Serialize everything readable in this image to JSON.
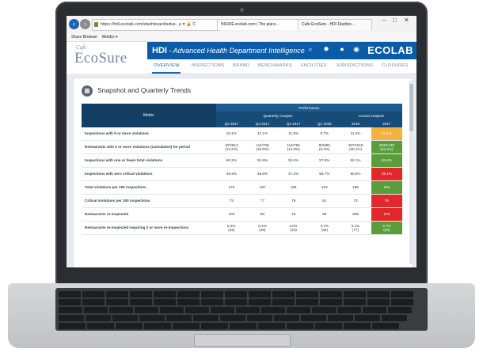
{
  "browser": {
    "address": "https://hdi.ecolab.com/dashboard/adva.. ρ ▾ 🔒 C",
    "tabs": [
      "INSIDE.ecolab.com | The place...",
      "Cafe EcoSure - HDI Dashbo..."
    ],
    "favorites": [
      "Share Browser",
      "WebEx ▾"
    ],
    "win_controls": [
      "–",
      "□",
      "✕"
    ]
  },
  "app": {
    "brand_small": "Cafe",
    "brand_large": "EcoSure",
    "title_main": "HDI",
    "title_sub": " - Advanced Health Department Intelligence",
    "company": "ECOLAB",
    "icons": [
      "search-icon",
      "gear-icon",
      "help-icon",
      "user-icon"
    ]
  },
  "nav": {
    "tabs": [
      "OVERVIEW",
      "INSPECTIONS",
      "BRAND",
      "BENCHMARKS",
      "FACILITIES",
      "JURISDICTIONS",
      "CLOSURES"
    ],
    "active": "OVERVIEW"
  },
  "section": {
    "title": "Snapshot and Quarterly Trends"
  },
  "table": {
    "performance_label": "Performance",
    "metric_label": "Metric",
    "quarterly_label": "Quarterly Analysis",
    "annual_label": "Annual Analysis",
    "columns": [
      "Q2 2017",
      "Q3 2017",
      "Q4 2017",
      "Q1 2018",
      "2016",
      "2017"
    ],
    "rows": [
      {
        "metric": "Inspections with 5 or more violations",
        "values": [
          "16.1%",
          "12.1%",
          "11.5%",
          "8.7%",
          "11.2%",
          "11.1%"
        ],
        "highlight": "yellow"
      },
      {
        "metric": "Restaurants with 5 or more violations (cumulative) for period",
        "values": [
          "107/813\n(13.2%)",
          "111/709\n(15.9%)",
          "114/766\n(14.9%)",
          "80/865\n(9.2%)",
          "457/1519\n(30.1%)",
          "433/1748\n(24.2%)"
        ],
        "highlight": "green"
      },
      {
        "metric": "Inspections with one or fewer total violations",
        "values": [
          "50.3%",
          "52.6%",
          "52.6%",
          "57.9%",
          "52.1%",
          "53.2%"
        ],
        "highlight": "green"
      },
      {
        "metric": "Inspections with zero critical violations",
        "values": [
          "49.3%",
          "48.5%",
          "47.2%",
          "55.7%",
          "50.8%",
          "49.1%"
        ],
        "highlight": "red"
      },
      {
        "metric": "Total violations per 100 inspections",
        "values": [
          "175",
          "197",
          "188",
          "103",
          "198",
          "192"
        ],
        "highlight": "green"
      },
      {
        "metric": "Critical violations per 100 inspections",
        "values": [
          "73",
          "77",
          "79",
          "61",
          "73",
          "76"
        ],
        "highlight": "red"
      },
      {
        "metric": "Restaurants re-inspected",
        "values": [
          "100",
          "90",
          "76",
          "68",
          "289",
          "276"
        ],
        "highlight": "red"
      },
      {
        "metric": "Restaurants re-inspected requiring 2 or more re-inspections",
        "values": [
          "5.3%\n(43)",
          "5.1%\n(36)",
          "3.0%\n(23)",
          "3.7%\n(32)",
          "5.1%\n(77)",
          "3.7%\n(64)"
        ],
        "highlight": "green"
      }
    ]
  },
  "colors": {
    "header_blue": "#0a5ca8",
    "table_header": "#174b78",
    "highlight_yellow": "#f3b33d",
    "highlight_green": "#5a9e3c",
    "highlight_red": "#e3282c"
  }
}
